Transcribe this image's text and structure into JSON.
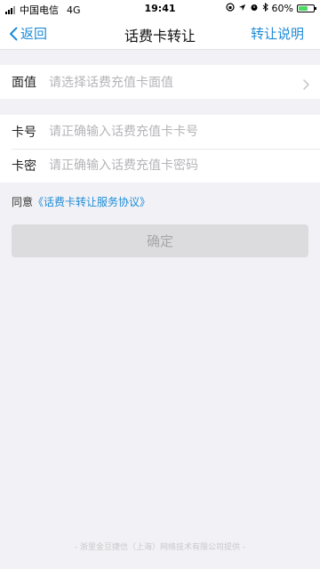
{
  "status_bar": {
    "carrier": "中国电信",
    "network": "4G",
    "time": "19:41",
    "battery_percent": "60%",
    "battery_level": 0.6
  },
  "nav": {
    "back_label": "返回",
    "title": "话费卡转让",
    "right_label": "转让说明"
  },
  "form": {
    "denomination": {
      "label": "面值",
      "placeholder": "请选择话费充值卡面值"
    },
    "card_number": {
      "label": "卡号",
      "placeholder": "请正确输入话费充值卡卡号"
    },
    "card_password": {
      "label": "卡密",
      "placeholder": "请正确输入话费充值卡密码"
    }
  },
  "agreement": {
    "prefix": "同意",
    "link_text": "《话费卡转让服务协议》"
  },
  "confirm_label": "确定",
  "footer_text": "- 浙里金豆捷信（上海）网络技术有限公司提供 -",
  "colors": {
    "accent": "#1e8bd6",
    "background": "#f2f2f6",
    "disabled_button": "#dcdcde"
  }
}
